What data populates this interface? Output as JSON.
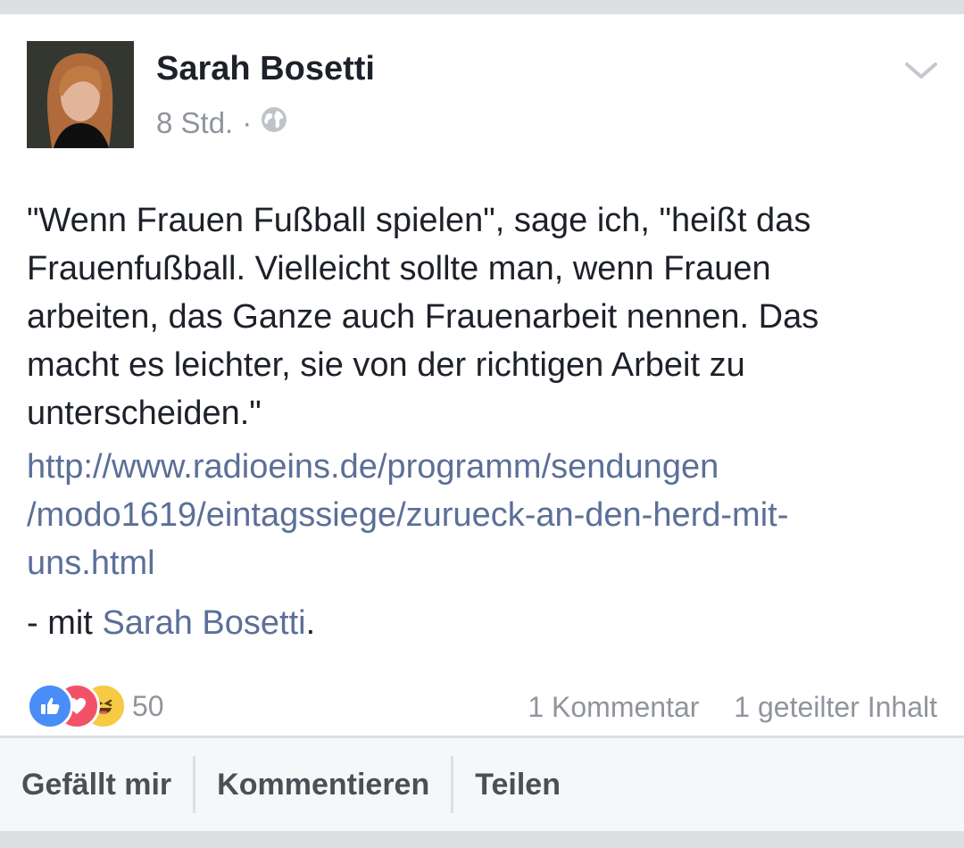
{
  "post": {
    "author": "Sarah Bosetti",
    "time": "8 Std.",
    "separator": "·",
    "privacy_icon": "globe-icon",
    "text_lines": [
      "\"Wenn Frauen Fußball spielen\", sage ich, \"heißt das",
      "Frauenfußball. Vielleicht sollte man, wenn Frauen",
      "arbeiten, das Ganze auch Frauenarbeit nennen. Das",
      "macht es leichter, sie von der richtigen Arbeit zu",
      "unterscheiden.\""
    ],
    "link_lines": [
      "http://www.radioeins.de/programm/sendungen",
      "/modo1619/eintagssiege/zurueck-an-den-herd-mit-",
      "uns.html"
    ],
    "with_prefix": "- mit ",
    "with_name": "Sarah Bosetti",
    "with_suffix": "."
  },
  "reactions": {
    "icons": [
      "like-icon",
      "love-icon",
      "haha-icon"
    ],
    "count": "50",
    "comments": "1 Kommentar",
    "shares": "1 geteilter Inhalt"
  },
  "actions": {
    "like": "Gefällt mir",
    "comment": "Kommentieren",
    "share": "Teilen"
  },
  "colors": {
    "link": "#5b6f98",
    "like": "#4a8df8",
    "love": "#f25268",
    "haha": "#f7c944"
  }
}
